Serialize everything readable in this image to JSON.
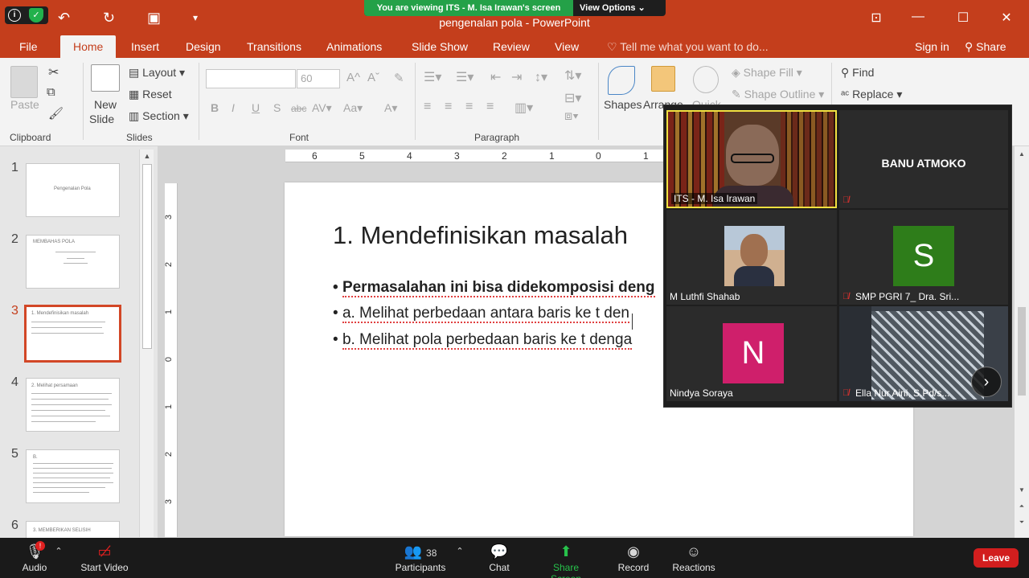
{
  "zoom": {
    "banner_text": "You are viewing ITS - M. Isa Irawan's screen",
    "view_options": "View Options",
    "participants_count": "38",
    "toolbar": {
      "audio": "Audio",
      "start_video": "Start Video",
      "participants": "Participants",
      "chat": "Chat",
      "share_screen": "Share Screen",
      "record": "Record",
      "reactions": "Reactions",
      "leave": "Leave"
    },
    "tiles": [
      {
        "name": "ITS - M. Isa Irawan"
      },
      {
        "name": "BANU ATMOKO"
      },
      {
        "name": "M Luthfi Shahab"
      },
      {
        "name": "SMP PGRI 7_ Dra. Sri...",
        "avatar": "S",
        "color": "#2e7d1a"
      },
      {
        "name": "Nindya Soraya",
        "avatar": "N",
        "color": "#cf1f6b"
      },
      {
        "name": "Ella Nur Aini, S.Pd/s..."
      }
    ]
  },
  "ppt": {
    "title": "pengenalan pola - PowerPoint",
    "tabs": [
      "File",
      "Home",
      "Insert",
      "Design",
      "Transitions",
      "Animations",
      "Slide Show",
      "Review",
      "View"
    ],
    "active_tab": "Home",
    "tell_me": "Tell me what you want to do...",
    "sign_in": "Sign in",
    "share": "Share",
    "ribbon": {
      "paste": "Paste",
      "clipboard": "Clipboard",
      "new_slide_1": "New",
      "new_slide_2": "Slide",
      "layout": "Layout",
      "reset": "Reset",
      "section": "Section",
      "slides": "Slides",
      "font_size": "60",
      "font": "Font",
      "paragraph": "Paragraph",
      "shapes": "Shapes",
      "arrange": "Arrange",
      "quick": "Quick",
      "shape_fill": "Shape Fill",
      "shape_outline": "Shape Outline",
      "find": "Find",
      "replace": "Replace"
    },
    "ruler_h": [
      "6",
      "5",
      "4",
      "3",
      "2",
      "1",
      "0",
      "1"
    ],
    "ruler_v": [
      "3",
      "2",
      "1",
      "0",
      "1",
      "2",
      "3"
    ],
    "thumbs": [
      {
        "num": "1",
        "text": "Pengenalan Pola"
      },
      {
        "num": "2",
        "text": "MEMBAHAS POLA"
      },
      {
        "num": "3",
        "text": "1. Mendefinisikan masalah"
      },
      {
        "num": "4",
        "text": "2. Melihat persamaan"
      },
      {
        "num": "5",
        "text": "B."
      },
      {
        "num": "6",
        "text": "3. MEMBERIKAN SELISIH"
      }
    ],
    "slide": {
      "title": "1. Mendefinisikan masalah",
      "bullet1": "Permasalahan ini bisa didekomposisi deng",
      "bullet2": "a.  Melihat perbedaan antara baris ke t den",
      "bullet3": "b.  Melihat pola perbedaan baris ke t denga"
    }
  }
}
